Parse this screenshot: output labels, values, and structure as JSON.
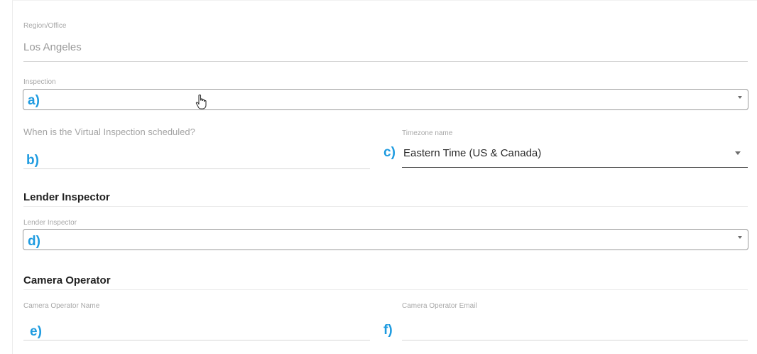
{
  "form": {
    "region": {
      "label": "Region/Office",
      "value": "Los Angeles"
    },
    "inspection": {
      "label": "Inspection",
      "annotation": "a)"
    },
    "schedule": {
      "question": "When is the Virtual Inspection scheduled?",
      "annotation": "b)"
    },
    "timezone": {
      "label": "Timezone name",
      "value": "Eastern Time (US & Canada)",
      "annotation": "c)"
    },
    "lender_section": {
      "heading": "Lender Inspector"
    },
    "lender": {
      "label": "Lender Inspector",
      "annotation": "d)"
    },
    "camera_section": {
      "heading": "Camera Operator"
    },
    "camera_name": {
      "label": "Camera Operator Name",
      "annotation": "e)"
    },
    "camera_email": {
      "label": "Camera Operator Email",
      "annotation": "f)"
    }
  },
  "colors": {
    "annotation": "#1e9be0",
    "label": "#a8a8a8",
    "border": "#9a9a9a"
  },
  "icons": [
    "chevron-down-icon",
    "hand-pointer-cursor-icon"
  ]
}
